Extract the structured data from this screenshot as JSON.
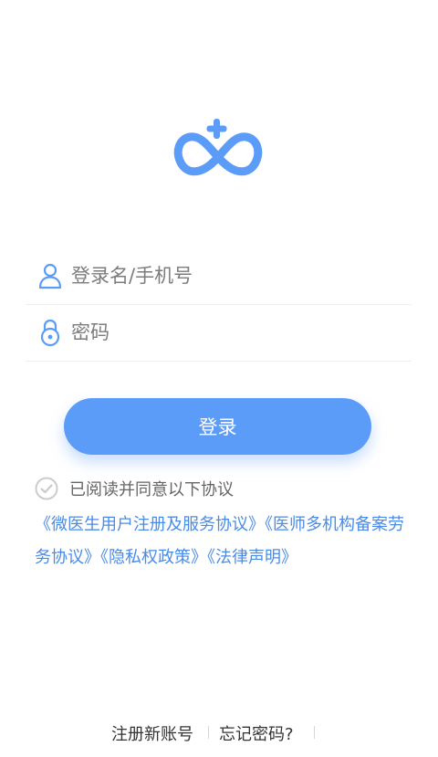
{
  "colors": {
    "accent": "#5b9cf8",
    "link": "#4a8be8"
  },
  "login_form": {
    "username_placeholder": "登录名/手机号",
    "password_placeholder": "密码",
    "submit_label": "登录"
  },
  "agreement": {
    "checked": false,
    "text": "已阅读并同意以下协议",
    "links": [
      "《微医生用户注册及服务协议》",
      "《医师多机构备案劳务协议》",
      "《隐私权政策》",
      "《法律声明》"
    ]
  },
  "footer": {
    "register_label": "注册新账号",
    "forgot_label": "忘记密码?"
  },
  "icons": [
    "logo-icon",
    "user-icon",
    "lock-icon",
    "check-circle-icon"
  ]
}
